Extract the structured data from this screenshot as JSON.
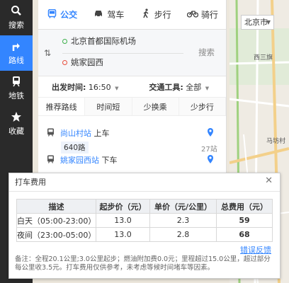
{
  "sidebar": {
    "items": [
      {
        "label": "搜索",
        "icon": "search-icon"
      },
      {
        "label": "路线",
        "icon": "route-icon"
      },
      {
        "label": "地铁",
        "icon": "subway-icon"
      },
      {
        "label": "收藏",
        "icon": "star-icon"
      }
    ],
    "active_color": "#3385ff"
  },
  "modes": [
    {
      "label": "公交",
      "icon": "bus-icon"
    },
    {
      "label": "驾车",
      "icon": "car-icon"
    },
    {
      "label": "步行",
      "icon": "walk-icon"
    },
    {
      "label": "骑行",
      "icon": "bike-icon"
    }
  ],
  "route": {
    "start": "北京首都国际机场",
    "end": "姚家园西",
    "search_label": "搜索"
  },
  "filters": {
    "depart_label": "出发时间:",
    "depart_value": "16:50",
    "tool_label": "交通工具:",
    "tool_value": "全部"
  },
  "sorts": [
    "推荐路线",
    "时间短",
    "少换乘",
    "少步行"
  ],
  "steps": {
    "board_station": "尚山村站",
    "board_action": "上车",
    "line": "640路",
    "stop_count": "27站",
    "alight_station": "姚家园西站",
    "alight_action": "下车"
  },
  "map": {
    "city": "北京市",
    "labels": [
      "西三旗",
      "马坊村"
    ]
  },
  "taxi": {
    "title": "打车费用",
    "headers": [
      "描述",
      "起步价（元）",
      "单价（元/公里）",
      "总费用（元）"
    ],
    "rows": [
      {
        "desc": "白天（05:00-23:00）",
        "start": "13.0",
        "unit": "2.3",
        "total": "59"
      },
      {
        "desc": "夜间（23:00-05:00）",
        "start": "13.0",
        "unit": "2.8",
        "total": "68"
      }
    ],
    "feedback": "错误反馈",
    "note": "备注：全程20.1公里;3.0公里起步；燃油附加费0.0元；里程超过15.0公里，超过部分每公里收3.5元。打车费用仅供参考，未考虑等候时间堵车等因素。"
  }
}
